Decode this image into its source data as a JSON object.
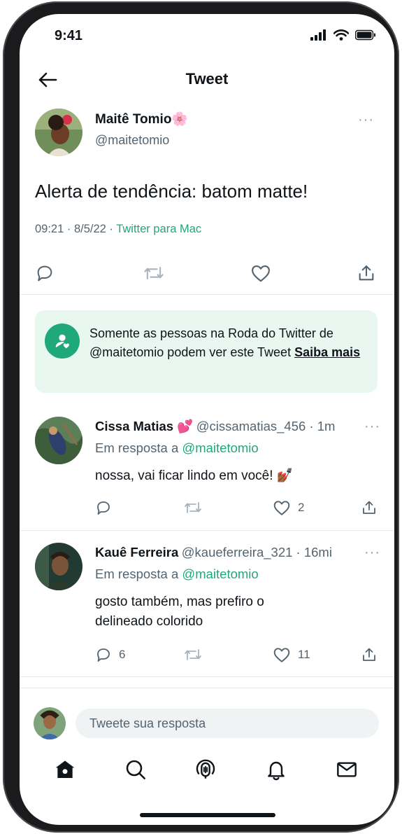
{
  "status_bar": {
    "time": "9:41"
  },
  "header": {
    "title": "Tweet"
  },
  "main_tweet": {
    "author_name": "Maitê Tomio🌸",
    "author_handle": "@maitetomio",
    "text": "Alerta de tendência: batom matte!",
    "timestamp": "09:21 · 8/5/22 · ",
    "source": "Twitter para Mac"
  },
  "circle_notice": {
    "text": "Somente as pessoas na Roda do Twitter de @maitetomio podem ver este Tweet ",
    "learn_more": "Saiba mais"
  },
  "replies": [
    {
      "name": "Cissa Matias 💕",
      "handle": "@cissamatias_456 · 1m",
      "reply_to_prefix": "Em resposta a ",
      "reply_to_mention": "@maitetomio",
      "text": "nossa, vai ficar lindo em você! 💅🏾",
      "reply_count": "",
      "like_count": "2"
    },
    {
      "name": "Kauê Ferreira",
      "handle": "@kaueferreira_321 · 16mi",
      "reply_to_prefix": "Em resposta a ",
      "reply_to_mention": "@maitetomio",
      "text": "gosto também, mas prefiro o delineado colorido",
      "reply_count": "6",
      "like_count": "11"
    }
  ],
  "compose": {
    "placeholder": "Tweete sua resposta"
  },
  "bottom_nav": [
    "home-icon",
    "search-icon",
    "spaces-icon",
    "notifications-icon",
    "messages-icon"
  ],
  "colors": {
    "accent": "#1fa87a",
    "text": "#0f1419",
    "secondary": "#536471",
    "banner": "#e8f8f1"
  }
}
